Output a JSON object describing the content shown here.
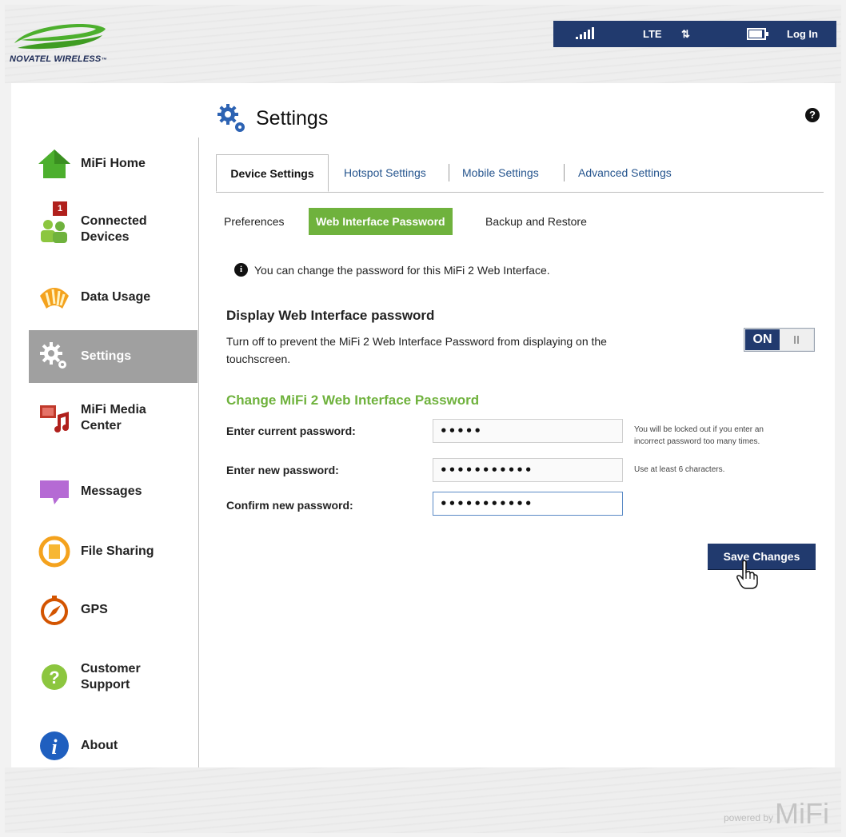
{
  "brand": {
    "logo_text": "NOVATEL WIRELESS",
    "trademark": "™",
    "powered_by": "powered by",
    "powered_brand": "MiFi"
  },
  "statusbar": {
    "signal_bars": 4,
    "network": "LTE",
    "data_arrows": "⇅",
    "battery_level": 0.8,
    "login_label": "Log In"
  },
  "sidebar": {
    "items": [
      {
        "label": "MiFi Home",
        "icon": "home-icon"
      },
      {
        "label": "Connected\nDevices",
        "icon": "connected-devices-icon",
        "badge": "1"
      },
      {
        "label": "Data Usage",
        "icon": "data-usage-icon"
      },
      {
        "label": "Settings",
        "icon": "settings-icon",
        "active": true
      },
      {
        "label": "MiFi Media\nCenter",
        "icon": "media-center-icon"
      },
      {
        "label": "Messages",
        "icon": "messages-icon"
      },
      {
        "label": "File Sharing",
        "icon": "file-sharing-icon"
      },
      {
        "label": "GPS",
        "icon": "gps-icon"
      },
      {
        "label": "Customer\nSupport",
        "icon": "customer-support-icon"
      },
      {
        "label": "About",
        "icon": "about-icon"
      }
    ]
  },
  "header": {
    "title": "Settings",
    "help": "?"
  },
  "tabs": [
    {
      "label": "Device Settings",
      "active": true
    },
    {
      "label": "Hotspot Settings"
    },
    {
      "label": "Mobile Settings"
    },
    {
      "label": "Advanced Settings"
    }
  ],
  "subtabs": [
    {
      "label": "Preferences"
    },
    {
      "label": "Web Interface Password",
      "active": true
    },
    {
      "label": "Backup and Restore"
    }
  ],
  "info": {
    "icon_glyph": "i",
    "text": "You can change the password for this MiFi 2 Web Interface."
  },
  "display_section": {
    "heading": "Display Web Interface password",
    "description": "Turn off to prevent the MiFi 2 Web Interface Password from displaying on the touchscreen.",
    "toggle_label": "ON",
    "toggle_state": true
  },
  "change_section": {
    "heading": "Change MiFi 2 Web Interface Password",
    "current_label": "Enter current password:",
    "current_value": "12345",
    "current_hint": "You will be locked out if you enter an incorrect password too many times.",
    "new_label": "Enter new password:",
    "new_value": "12345678901",
    "new_hint": "Use at least 6 characters.",
    "confirm_label": "Confirm new password:",
    "confirm_value": "12345678901",
    "save_label": "Save Changes"
  },
  "colors": {
    "navy": "#213a6e",
    "green": "#6fb23d",
    "active_nav": "#a0a0a0",
    "badge_red": "#b0201c"
  }
}
